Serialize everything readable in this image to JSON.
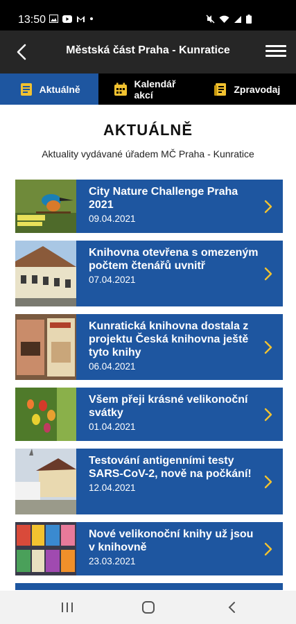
{
  "status": {
    "time": "13:50"
  },
  "header": {
    "title": "Městská část Praha - Kunratice"
  },
  "tabs": [
    {
      "label": "Aktuálně",
      "icon": "news-icon",
      "active": true
    },
    {
      "label": "Kalendář akcí",
      "icon": "calendar-icon",
      "active": false
    },
    {
      "label": "Zpravodaj",
      "icon": "newsletter-icon",
      "active": false
    }
  ],
  "page": {
    "title": "AKTUÁLNĚ",
    "subtitle": "Aktuality vydávané úřadem MČ Praha - Kunratice"
  },
  "news": [
    {
      "title": "City Nature Challenge Praha 2021",
      "date": "09.04.2021",
      "thumb": "kingfisher"
    },
    {
      "title": "Knihovna otevřena s omezeným počtem čtenářů uvnitř",
      "date": "07.04.2021",
      "thumb": "building"
    },
    {
      "title": "Kunratická knihovna dostala z projektu Česká knihovna ještě tyto knihy",
      "date": "06.04.2021",
      "thumb": "books"
    },
    {
      "title": "Všem přeji krásné velikonoční svátky",
      "date": "01.04.2021",
      "thumb": "easter-eggs"
    },
    {
      "title": "Testování antigenními testy SARS-CoV-2, nově na počkání!",
      "date": "12.04.2021",
      "thumb": "testing-site"
    },
    {
      "title": "Nové velikonoční knihy už jsou v knihovně",
      "date": "23.03.2021",
      "thumb": "book-shelf"
    }
  ],
  "colors": {
    "accent": "#1e56a0",
    "header": "#262626",
    "tabs": "#000000"
  }
}
